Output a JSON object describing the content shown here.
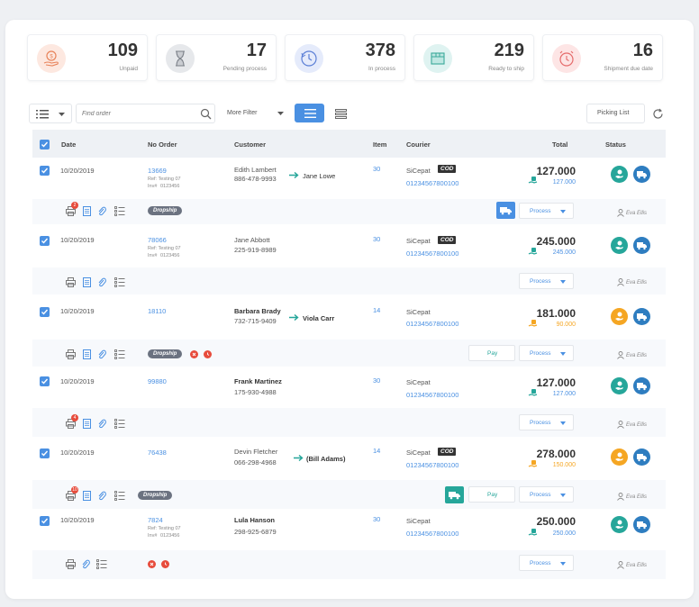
{
  "stats": [
    {
      "value": "109",
      "label": "Unpaid",
      "icon": "hand-coin-icon",
      "color": "#fde8e0"
    },
    {
      "value": "17",
      "label": "Pending process",
      "icon": "hourglass-icon",
      "color": "#eceef0"
    },
    {
      "value": "378",
      "label": "In process",
      "icon": "clock-refresh-icon",
      "color": "#e5ebfb"
    },
    {
      "value": "219",
      "label": "Ready to ship",
      "icon": "box-icon",
      "color": "#dff3f1"
    },
    {
      "value": "16",
      "label": "Shipment due date",
      "icon": "alarm-clock-icon",
      "color": "#fde5e5"
    }
  ],
  "toolbar": {
    "search_placeholder": "Find order",
    "filter_label": "More Filter",
    "picking_label": "Picking List"
  },
  "columns": {
    "date": "Date",
    "order": "No Order",
    "customer": "Customer",
    "item": "Item",
    "courier": "Courier",
    "total": "Total",
    "status": "Status"
  },
  "orders": [
    {
      "date": "10/20/2019",
      "order": "13669",
      "ref": "Ref: Testing 07",
      "inv_label": "Inv#",
      "inv": "0123456",
      "customer": "Edith Lambert",
      "phone": "886-478-9993",
      "recipient": "Jane Lowe",
      "item": "30",
      "courier": "SiCepat",
      "awb": "01234567800100",
      "cod": "COD",
      "total": "127.000",
      "paid": "127.000",
      "tag": "Dropship",
      "user": "Eva Ellis",
      "process": "Process",
      "pay": ""
    },
    {
      "date": "10/20/2019",
      "order": "78066",
      "ref": "Ref: Testing 07",
      "inv_label": "Inv#",
      "inv": "0123456",
      "customer": "Jane Abbott",
      "phone": "225-919-8989",
      "recipient": "",
      "item": "30",
      "courier": "SiCepat",
      "awb": "01234567800100",
      "cod": "COD",
      "total": "245.000",
      "paid": "245.000",
      "tag": "",
      "user": "Eva Ellis",
      "process": "Process",
      "pay": ""
    },
    {
      "date": "10/20/2019",
      "order": "18110",
      "ref": "",
      "inv_label": "",
      "inv": "",
      "customer": "Barbara Brady",
      "phone": "732-715-9409",
      "recipient": "Viola Carr",
      "item": "14",
      "courier": "SiCepat",
      "awb": "01234567800100",
      "cod": "",
      "total": "181.000",
      "paid": "90.000",
      "tag": "Dropship",
      "user": "Eva Ellis",
      "process": "Process",
      "pay": "Pay"
    },
    {
      "date": "10/20/2019",
      "order": "99880",
      "ref": "",
      "inv_label": "",
      "inv": "",
      "customer": "Frank Martinez",
      "phone": "175-930-4988",
      "recipient": "",
      "item": "30",
      "courier": "SiCepat",
      "awb": "01234567800100",
      "cod": "",
      "total": "127.000",
      "paid": "127.000",
      "tag": "",
      "user": "Eva Ellis",
      "process": "Process",
      "pay": ""
    },
    {
      "date": "10/20/2019",
      "order": "76438",
      "ref": "",
      "inv_label": "",
      "inv": "",
      "customer": "Devin Fletcher",
      "phone": "066-298-4968",
      "recipient": "(Bill Adams)",
      "item": "14",
      "courier": "SiCepat",
      "awb": "01234567800100",
      "cod": "COD",
      "total": "278.000",
      "paid": "150.000",
      "tag": "Dropship",
      "user": "Eva Ellis",
      "process": "Process",
      "pay": "Pay"
    },
    {
      "date": "10/20/2019",
      "order": "7824",
      "ref": "Ref: Testing 07",
      "inv_label": "Inv#",
      "inv": "0123456",
      "customer": "Lula Hanson",
      "phone": "298-925-6879",
      "recipient": "",
      "item": "30",
      "courier": "SiCepat",
      "awb": "01234567800100",
      "cod": "",
      "total": "250.000",
      "paid": "250.000",
      "tag": "",
      "user": "Eva Ellis",
      "process": "Process",
      "pay": ""
    }
  ],
  "badges": [
    "2",
    "4",
    "10"
  ],
  "colors": {
    "accent": "#4a90e2",
    "teal": "#26a69a",
    "blue": "#2e7dc0",
    "orange": "#f5a623",
    "red": "#e74c3c"
  }
}
